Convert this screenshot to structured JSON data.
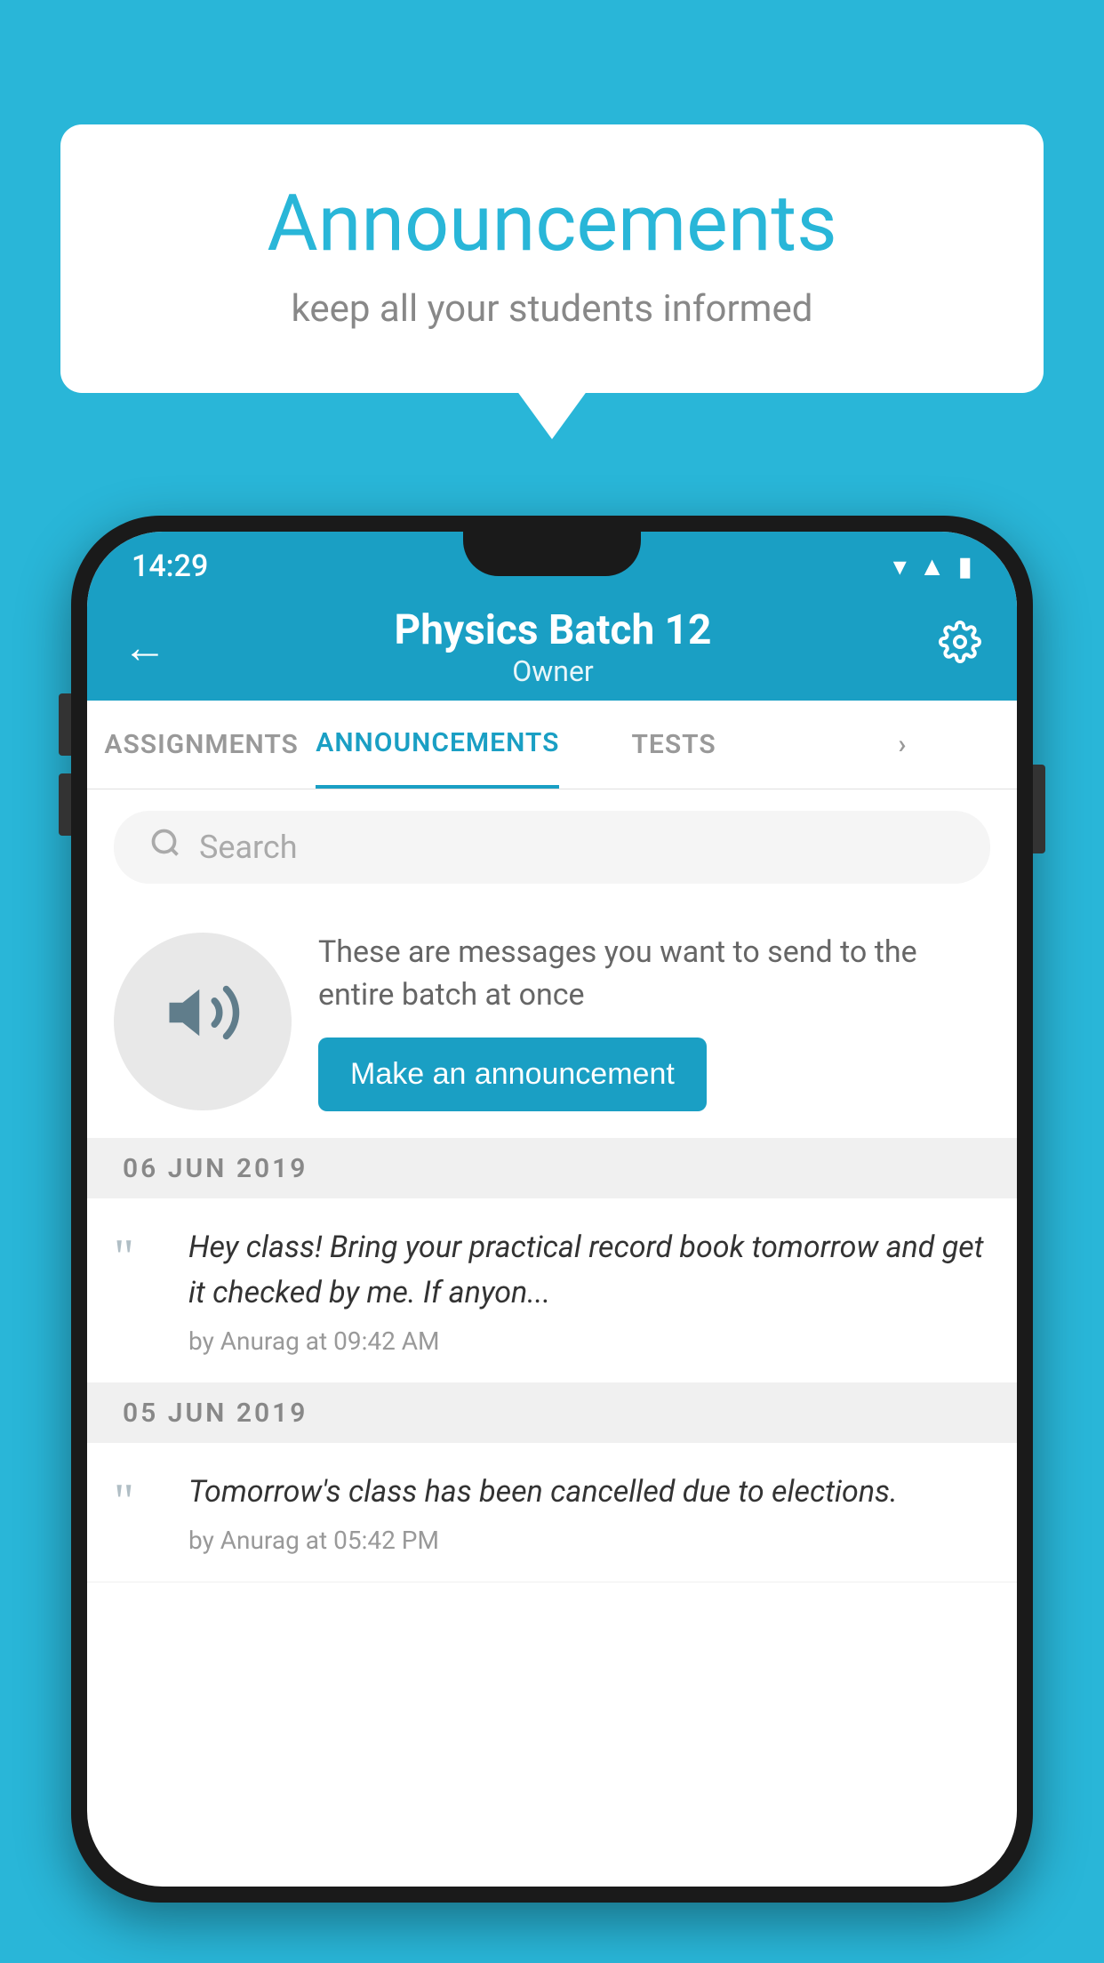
{
  "background_color": "#29b6d8",
  "bubble": {
    "title": "Announcements",
    "subtitle": "keep all your students informed"
  },
  "phone": {
    "status_bar": {
      "time": "14:29"
    },
    "app_bar": {
      "title": "Physics Batch 12",
      "subtitle": "Owner",
      "back_icon": "←",
      "settings_icon": "⚙"
    },
    "tabs": [
      {
        "label": "ASSIGNMENTS",
        "active": false
      },
      {
        "label": "ANNOUNCEMENTS",
        "active": true
      },
      {
        "label": "TESTS",
        "active": false
      },
      {
        "label": "›",
        "active": false
      }
    ],
    "search": {
      "placeholder": "Search"
    },
    "promo": {
      "description": "These are messages you want to send to the entire batch at once",
      "button_label": "Make an announcement"
    },
    "announcements": [
      {
        "date": "06  JUN  2019",
        "text": "Hey class! Bring your practical record book tomorrow and get it checked by me. If anyon...",
        "meta": "by Anurag at 09:42 AM"
      },
      {
        "date": "05  JUN  2019",
        "text": "Tomorrow's class has been cancelled due to elections.",
        "meta": "by Anurag at 05:42 PM"
      }
    ]
  }
}
